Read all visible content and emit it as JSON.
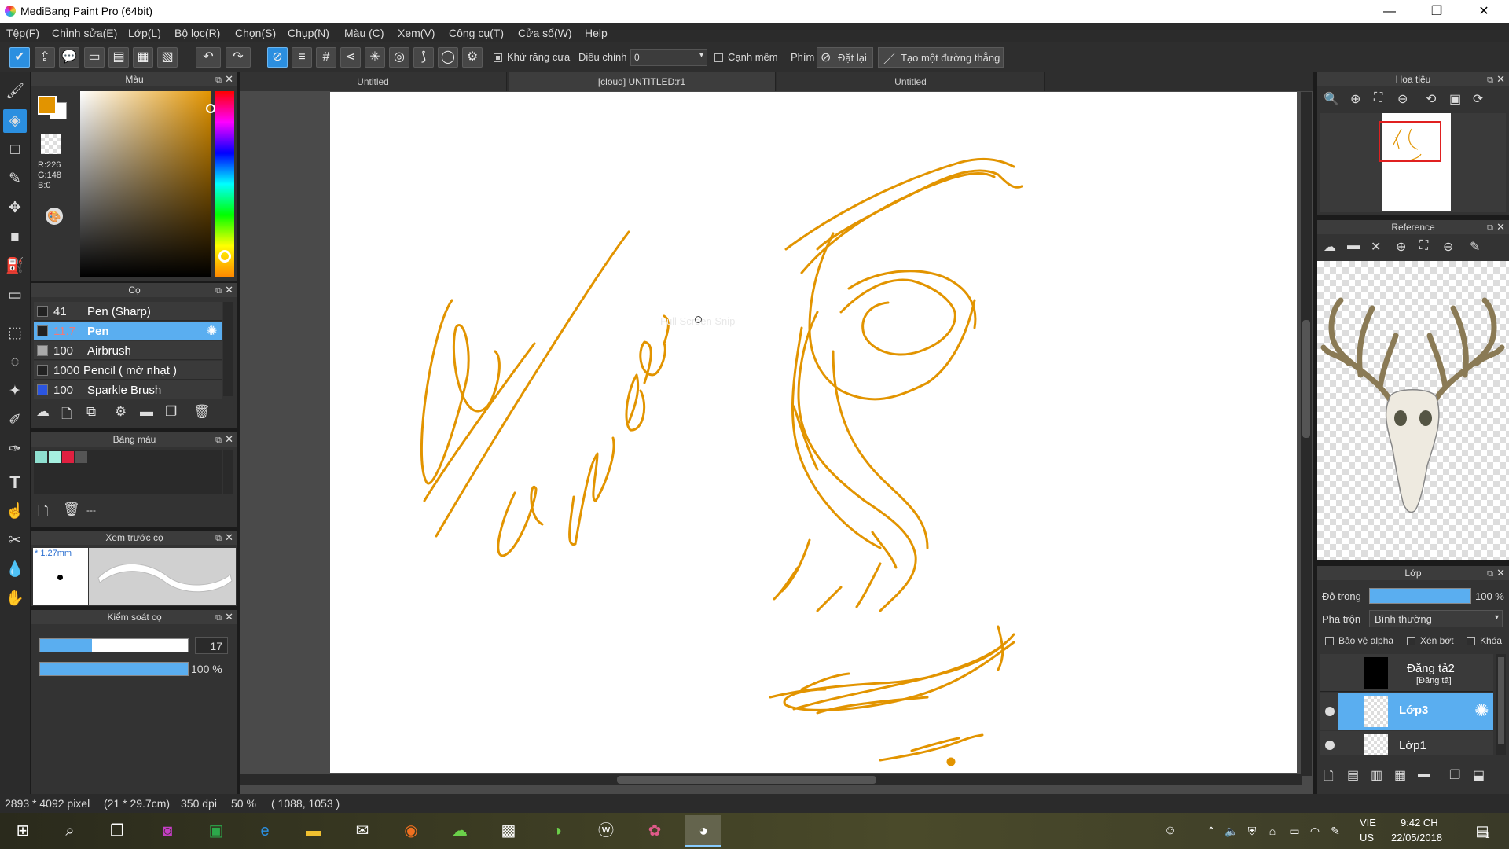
{
  "window": {
    "title": "MediBang Paint Pro (64bit)",
    "minimize": "—",
    "maximize": "❐",
    "close": "✕"
  },
  "menu": [
    "Tệp(F)",
    "Chỉnh sửa(E)",
    "Lớp(L)",
    "Bộ lọc(R)",
    "Chọn(S)",
    "Chụp(N)",
    "Màu (C)",
    "Xem(V)",
    "Công cụ(T)",
    "Cửa sổ(W)",
    "Help"
  ],
  "toolbar": {
    "antialias_label": "Khử răng cưa",
    "adjust_label": "Điều chỉnh",
    "adjust_value": "0",
    "smooth_label": "Cạnh mềm",
    "key_label": "Phím",
    "reset_label": "Đặt lại",
    "line_label": "Tạo một đường thẳng"
  },
  "color_panel": {
    "title": "Màu",
    "r": "R:226",
    "g": "G:148",
    "b": "B:0",
    "main_color": "#e29400"
  },
  "brush_panel": {
    "title": "Cọ",
    "brushes": [
      {
        "size": "41",
        "name": "Pen (Sharp)",
        "swatch": "#222222"
      },
      {
        "size": "11.7",
        "name": "Pen",
        "swatch": "#222222"
      },
      {
        "size": "100",
        "name": "Airbrush",
        "swatch": "#aaaaaa"
      },
      {
        "size": "1000",
        "name": "Pencil ( mờ nhạt )",
        "swatch": "#222222"
      },
      {
        "size": "100",
        "name": "Sparkle Brush",
        "swatch": "#2b55e0"
      }
    ]
  },
  "palette_panel": {
    "title": "Bảng màu",
    "swatches": [
      "#8fe0d0",
      "#a6f0e0",
      "#e02040",
      "#555555"
    ],
    "dash": "---"
  },
  "preview_panel": {
    "title": "Xem trước cọ",
    "size_label": "* 1.27mm"
  },
  "control_panel": {
    "title": "Kiểm soát cọ",
    "size_value": "17",
    "opacity_label": "100 %",
    "size_fraction": 0.35,
    "opacity_fraction": 1.0
  },
  "tabs": [
    "Untitled",
    "[cloud] UNTITLED:r1",
    "Untitled"
  ],
  "canvas": {
    "ghost_text": "Full Screen Snip",
    "stroke_color": "#e29400"
  },
  "navigator": {
    "title": "Hoa tiêu"
  },
  "reference": {
    "title": "Reference"
  },
  "layer_panel": {
    "title": "Lớp",
    "opacity_label": "Độ trong",
    "opacity_value": "100 %",
    "opacity_fraction": 1.0,
    "blend_label": "Pha trộn",
    "blend_value": "Bình thường",
    "protect_alpha": "Bảo vệ alpha",
    "clip": "Xén bớt",
    "lock": "Khóa",
    "layers": [
      {
        "name": "Đăng tả2",
        "sub": "[Đăng tả]"
      },
      {
        "name": "Lớp3",
        "sub": ""
      },
      {
        "name": "Lớp1",
        "sub": ""
      }
    ]
  },
  "status": {
    "size": "2893 * 4092 pixel",
    "cm": "(21 * 29.7cm)",
    "dpi": "350 dpi",
    "zoom": "50 %",
    "cursor": "( 1088, 1053 )"
  },
  "taskbar": {
    "lang1": "VIE",
    "lang2": "US",
    "time": "9:42 CH",
    "date": "22/05/2018",
    "notif": "1"
  }
}
